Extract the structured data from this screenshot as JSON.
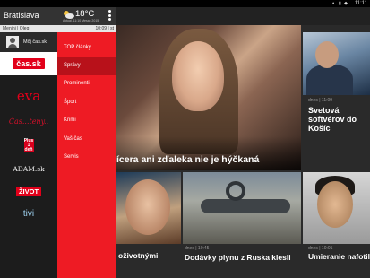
{
  "status_bar": {
    "time": "11:11",
    "system_icons": "▲ ▮ ◆"
  },
  "header": {
    "city": "Bratislava",
    "temperature": "18°C",
    "weather_subtext": "Aktual. 11:10 Mesac 2015",
    "weather_icon": "sun-cloud-icon",
    "menu_icon": "overflow-menu-icon"
  },
  "subheader": {
    "namedays": "Meninj | Oleg",
    "clock": "10:09 | st"
  },
  "user": {
    "label": "Môj čas.sk",
    "icon": "user-avatar-icon"
  },
  "brands": [
    {
      "label": "čas.sk"
    },
    {
      "label": "eva"
    },
    {
      "label": "Čas...teny.."
    },
    {
      "label": "Plus 1 deň"
    },
    {
      "label": "ADAM.sk"
    },
    {
      "label": "ŽIVOT"
    },
    {
      "label": "tivi"
    }
  ],
  "menu": [
    {
      "label": "TOP články"
    },
    {
      "label": "Správy"
    },
    {
      "label": "Prominenti"
    },
    {
      "label": "Šport"
    },
    {
      "label": "Krimi"
    },
    {
      "label": "Vaš čas"
    },
    {
      "label": "Servis"
    }
  ],
  "active_menu_index": 1,
  "articles": {
    "hero": {
      "title": "ícera ani zďaleka nie je hýčkaná"
    },
    "right1": {
      "meta": "dnes | 11:09",
      "title": "Svetová softvérov do Košíc"
    },
    "boy": {
      "title": "oživotnými"
    },
    "pipe": {
      "meta": "dnes | 10:45",
      "title": "Dodávky plynu z Ruska klesli"
    },
    "asian": {
      "meta": "dnes | 10:01",
      "title": "Umieranie nafotil"
    }
  },
  "colors": {
    "accent": "#ee1b24",
    "accent_dark": "#b8111a",
    "drawer_dark": "#1c1c1c"
  }
}
